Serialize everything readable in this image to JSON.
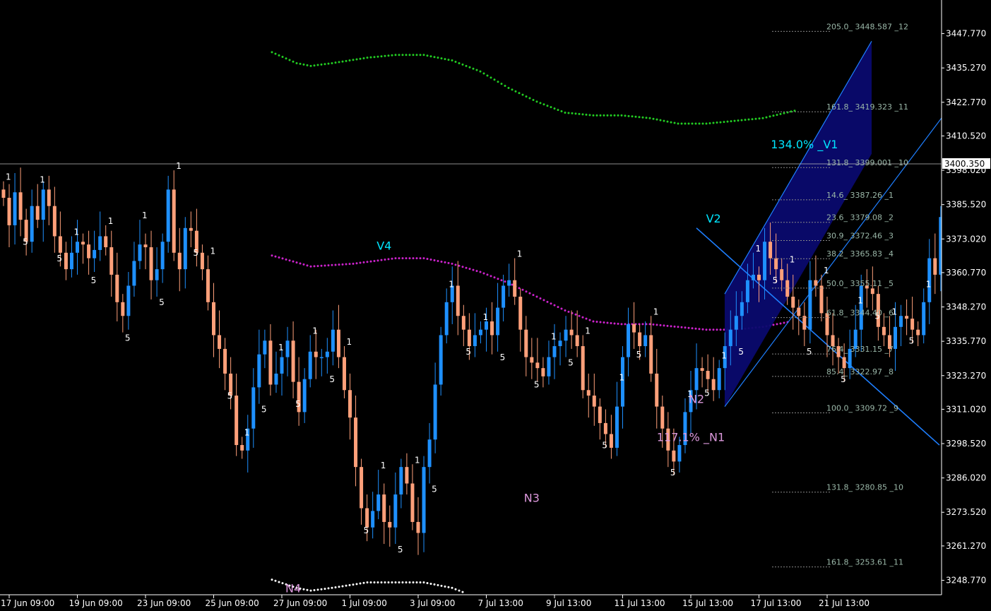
{
  "chart_data": {
    "type": "candlestick",
    "colors": {
      "background": "#000000",
      "axis": "#ffffff",
      "bull": "#1e90ff",
      "bear": "#ffa07a",
      "upper_band": "#22cc22",
      "middle_band": "#cc22cc",
      "lower_band": "#ffffff",
      "channel_fill": "#0a0a6e",
      "trendline": "#1e7fff",
      "wave_up": "#00e5ff",
      "wave_down": "#dd99dd",
      "fib_text": "#9ab7a8",
      "fib_line": "#888888"
    },
    "ylim": [
      3243.5,
      3460.0
    ],
    "y_ticks": [
      "3447.770",
      "3435.270",
      "3422.770",
      "3410.520",
      "3398.020",
      "3385.520",
      "3373.020",
      "3360.770",
      "3348.270",
      "3335.770",
      "3323.270",
      "3311.020",
      "3298.520",
      "3286.020",
      "3273.520",
      "3261.270",
      "3248.770"
    ],
    "current_price": "3400.350",
    "x_ticks": [
      "17 Jun 09:00",
      "19 Jun 09:00",
      "23 Jun 09:00",
      "25 Jun 09:00",
      "27 Jun 09:00",
      "1 Jul 09:00",
      "3 Jul 09:00",
      "7 Jul 13:00",
      "9 Jul 13:00",
      "11 Jul 13:00",
      "15 Jul 13:00",
      "17 Jul 13:00",
      "21 Jul 13:00"
    ],
    "bars_per_tick": 12,
    "closes": [
      3388,
      3378,
      3390,
      3380,
      3372,
      3385,
      3380,
      3391,
      3385,
      3374,
      3368,
      3362,
      3368,
      3372,
      3371,
      3366,
      3369,
      3374,
      3370,
      3360,
      3350,
      3345,
      3356,
      3365,
      3371,
      3370,
      3358,
      3362,
      3372,
      3391,
      3368,
      3362,
      3377,
      3376,
      3368,
      3362,
      3350,
      3338,
      3333,
      3324,
      3316,
      3298,
      3296,
      3304,
      3319,
      3331,
      3336,
      3320,
      3324,
      3330,
      3336,
      3321,
      3310,
      3322,
      3332,
      3330,
      3330,
      3332,
      3340,
      3330,
      3318,
      3308,
      3290,
      3275,
      3268,
      3274,
      3280,
      3270,
      3268,
      3280,
      3290,
      3284,
      3270,
      3266,
      3290,
      3300,
      3320,
      3338,
      3350,
      3356,
      3345,
      3340,
      3334,
      3338,
      3340,
      3343,
      3338,
      3348,
      3356,
      3358,
      3352,
      3340,
      3330,
      3328,
      3326,
      3323,
      3330,
      3334,
      3336,
      3340,
      3338,
      3334,
      3318,
      3316,
      3312,
      3306,
      3302,
      3297,
      3312,
      3330,
      3342,
      3339,
      3334,
      3338,
      3324,
      3312,
      3304,
      3296,
      3292,
      3298,
      3310,
      3318,
      3326,
      3325,
      3322,
      3318,
      3326,
      3334,
      3340,
      3345,
      3350,
      3358,
      3360,
      3358,
      3372,
      3366,
      3362,
      3358,
      3352,
      3348,
      3345,
      3340,
      3358,
      3356,
      3346,
      3338,
      3334,
      3330,
      3326,
      3333,
      3340,
      3356,
      3355,
      3353,
      3341,
      3338,
      3333,
      3341,
      3345,
      3344,
      3340,
      3338,
      3350,
      3366,
      3360,
      3381,
      3396,
      3402
    ],
    "upper_band_x": [
      385,
      420,
      440,
      470,
      520,
      560,
      600,
      640,
      680,
      720,
      760,
      800,
      840,
      880,
      920,
      960,
      1000,
      1040,
      1080,
      1130
    ],
    "upper_band_y": [
      3441,
      3437,
      3436,
      3437,
      3439,
      3440,
      3440,
      3438,
      3434,
      3428,
      3423,
      3419,
      3418,
      3418,
      3417,
      3415,
      3415,
      3416,
      3417,
      3420
    ],
    "middle_band_x": [
      385,
      440,
      500,
      560,
      600,
      640,
      680,
      720,
      760,
      800,
      840,
      880,
      920,
      960,
      1000,
      1040,
      1080,
      1120
    ],
    "middle_band_y": [
      3367,
      3363,
      3364,
      3366,
      3366,
      3364,
      3361,
      3357,
      3352,
      3347,
      3343,
      3342,
      3342,
      3341,
      3340,
      3340,
      3341,
      3343
    ],
    "lower_band_x": [
      385,
      420,
      440,
      470,
      520,
      560,
      600,
      620,
      640,
      660
    ],
    "lower_band_y": [
      3249,
      3246,
      3245,
      3246,
      3248,
      3248,
      3248,
      3247,
      3246,
      3244
    ],
    "channel_x": [
      1026,
      1026,
      1234,
      1234
    ],
    "channel_y": [
      3312,
      3353,
      3445,
      3404
    ],
    "trend_lower_x": [
      1026,
      1403
    ],
    "trend_lower_y": [
      3312,
      3441
    ],
    "trend_down_x": [
      986,
      1330
    ],
    "trend_down_y": [
      3377,
      3298
    ],
    "wave_labels": [
      {
        "text": "V4",
        "x": "1 Jul 09:00 +6",
        "y": 3367,
        "type": "up"
      },
      {
        "text": "V2",
        "x": "15 Jul 13:00 +4",
        "y": 3377,
        "type": "up"
      },
      {
        "text": "134.0% _V1",
        "x": "17 Jul 13:00 +8",
        "y": 3404,
        "type": "up"
      },
      {
        "text": "N4",
        "x": "27 Jun 09:00 +2",
        "y": 3249,
        "type": "down"
      },
      {
        "text": "N3",
        "x": "7 Jul 13:00 +8",
        "y": 3282,
        "type": "down"
      },
      {
        "text": "N2",
        "x": "15 Jul 13:00 +1",
        "y": 3318,
        "type": "down"
      },
      {
        "text": "117.1% _N1",
        "x": "15 Jul 13:00",
        "y": 3304,
        "type": "down"
      }
    ],
    "fib_levels": [
      {
        "label": "205.0_ 3448.587 _12",
        "value": 3448.587
      },
      {
        "label": "161.8_ 3419.323 _11",
        "value": 3419.323
      },
      {
        "label": "131.8_ 3399.001 _10",
        "value": 3399.001
      },
      {
        "label": "14.6_ 3387.26 _1",
        "value": 3387.26
      },
      {
        "label": "23.6_ 3379.08 _2",
        "value": 3379.08
      },
      {
        "label": "30.9_ 3372.46 _3",
        "value": 3372.46
      },
      {
        "label": "38.2_ 3365.83 _4",
        "value": 3365.83
      },
      {
        "label": "50.0_ 3355.11 _5",
        "value": 3355.11
      },
      {
        "label": "61.8_ 3344.40 _6",
        "value": 3344.4
      },
      {
        "label": "76.4_ 3331.15 _7",
        "value": 3331.15
      },
      {
        "label": "85.4_ 3322.97 _8",
        "value": 3322.97
      },
      {
        "label": "100.0_ 3309.72 _9",
        "value": 3309.72
      },
      {
        "label": "131.8_ 3280.85 _10",
        "value": 3280.85
      },
      {
        "label": "161.8_ 3253.61 _11",
        "value": 3253.61
      }
    ],
    "markers_one": "1",
    "markers_five": "5"
  }
}
